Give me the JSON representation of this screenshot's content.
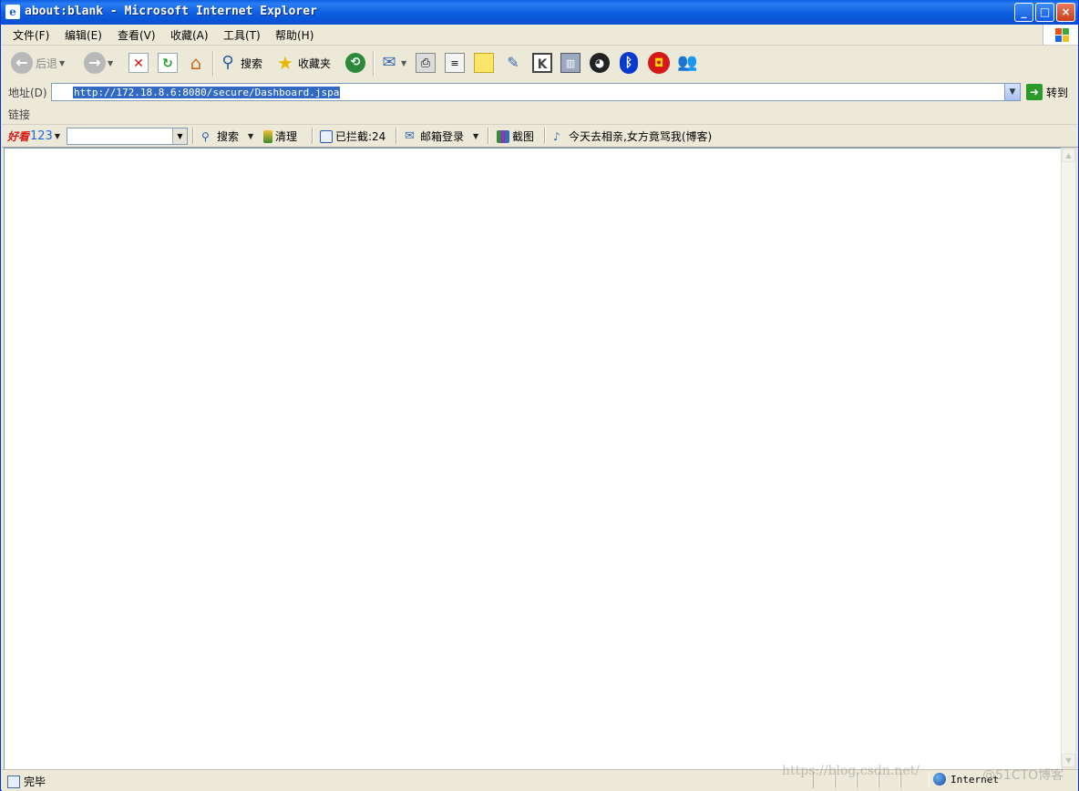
{
  "window": {
    "title": "about:blank - Microsoft Internet Explorer",
    "controls": [
      "_",
      "□",
      "×"
    ]
  },
  "menu": {
    "items": [
      {
        "label": "文件(F)"
      },
      {
        "label": "编辑(E)"
      },
      {
        "label": "查看(V)"
      },
      {
        "label": "收藏(A)"
      },
      {
        "label": "工具(T)"
      },
      {
        "label": "帮助(H)"
      }
    ]
  },
  "toolbar": {
    "back_label": "后退",
    "search_label": "搜索",
    "favorites_label": "收藏夹",
    "icons": [
      "back-icon",
      "forward-icon",
      "stop-icon",
      "refresh-icon",
      "home-icon",
      "search-icon",
      "favorites-star-icon",
      "history-icon",
      "mail-icon",
      "print-icon",
      "edit-icon",
      "note-icon",
      "messenger-icon",
      "k-icon",
      "tool-icon",
      "qq-penguin-icon",
      "bluetooth-icon",
      "emblem-icon",
      "msn-people-icon"
    ]
  },
  "address": {
    "label": "地址(D)",
    "url": "http://172.18.8.6:8080/secure/Dashboard.jspa",
    "go_label": "转到"
  },
  "links": {
    "label": "链接"
  },
  "sogou": {
    "brand_text": "好看",
    "brand_num": "123",
    "search_label": "搜索",
    "clean_label": "清理",
    "blocked_label": "已拦截:24",
    "mail_label": "邮箱登录",
    "screenshot_label": "截图",
    "news_label": "今天去相亲,女方竟骂我(博客)"
  },
  "status": {
    "text": "完毕",
    "zone": "Internet"
  },
  "watermark": {
    "url": "https://blog.csdn.net/",
    "brand": "@51CTO博客"
  },
  "colors": {
    "titlebar": "#0a5fe0",
    "chrome": "#ece9d8",
    "selection": "#316ac5"
  }
}
